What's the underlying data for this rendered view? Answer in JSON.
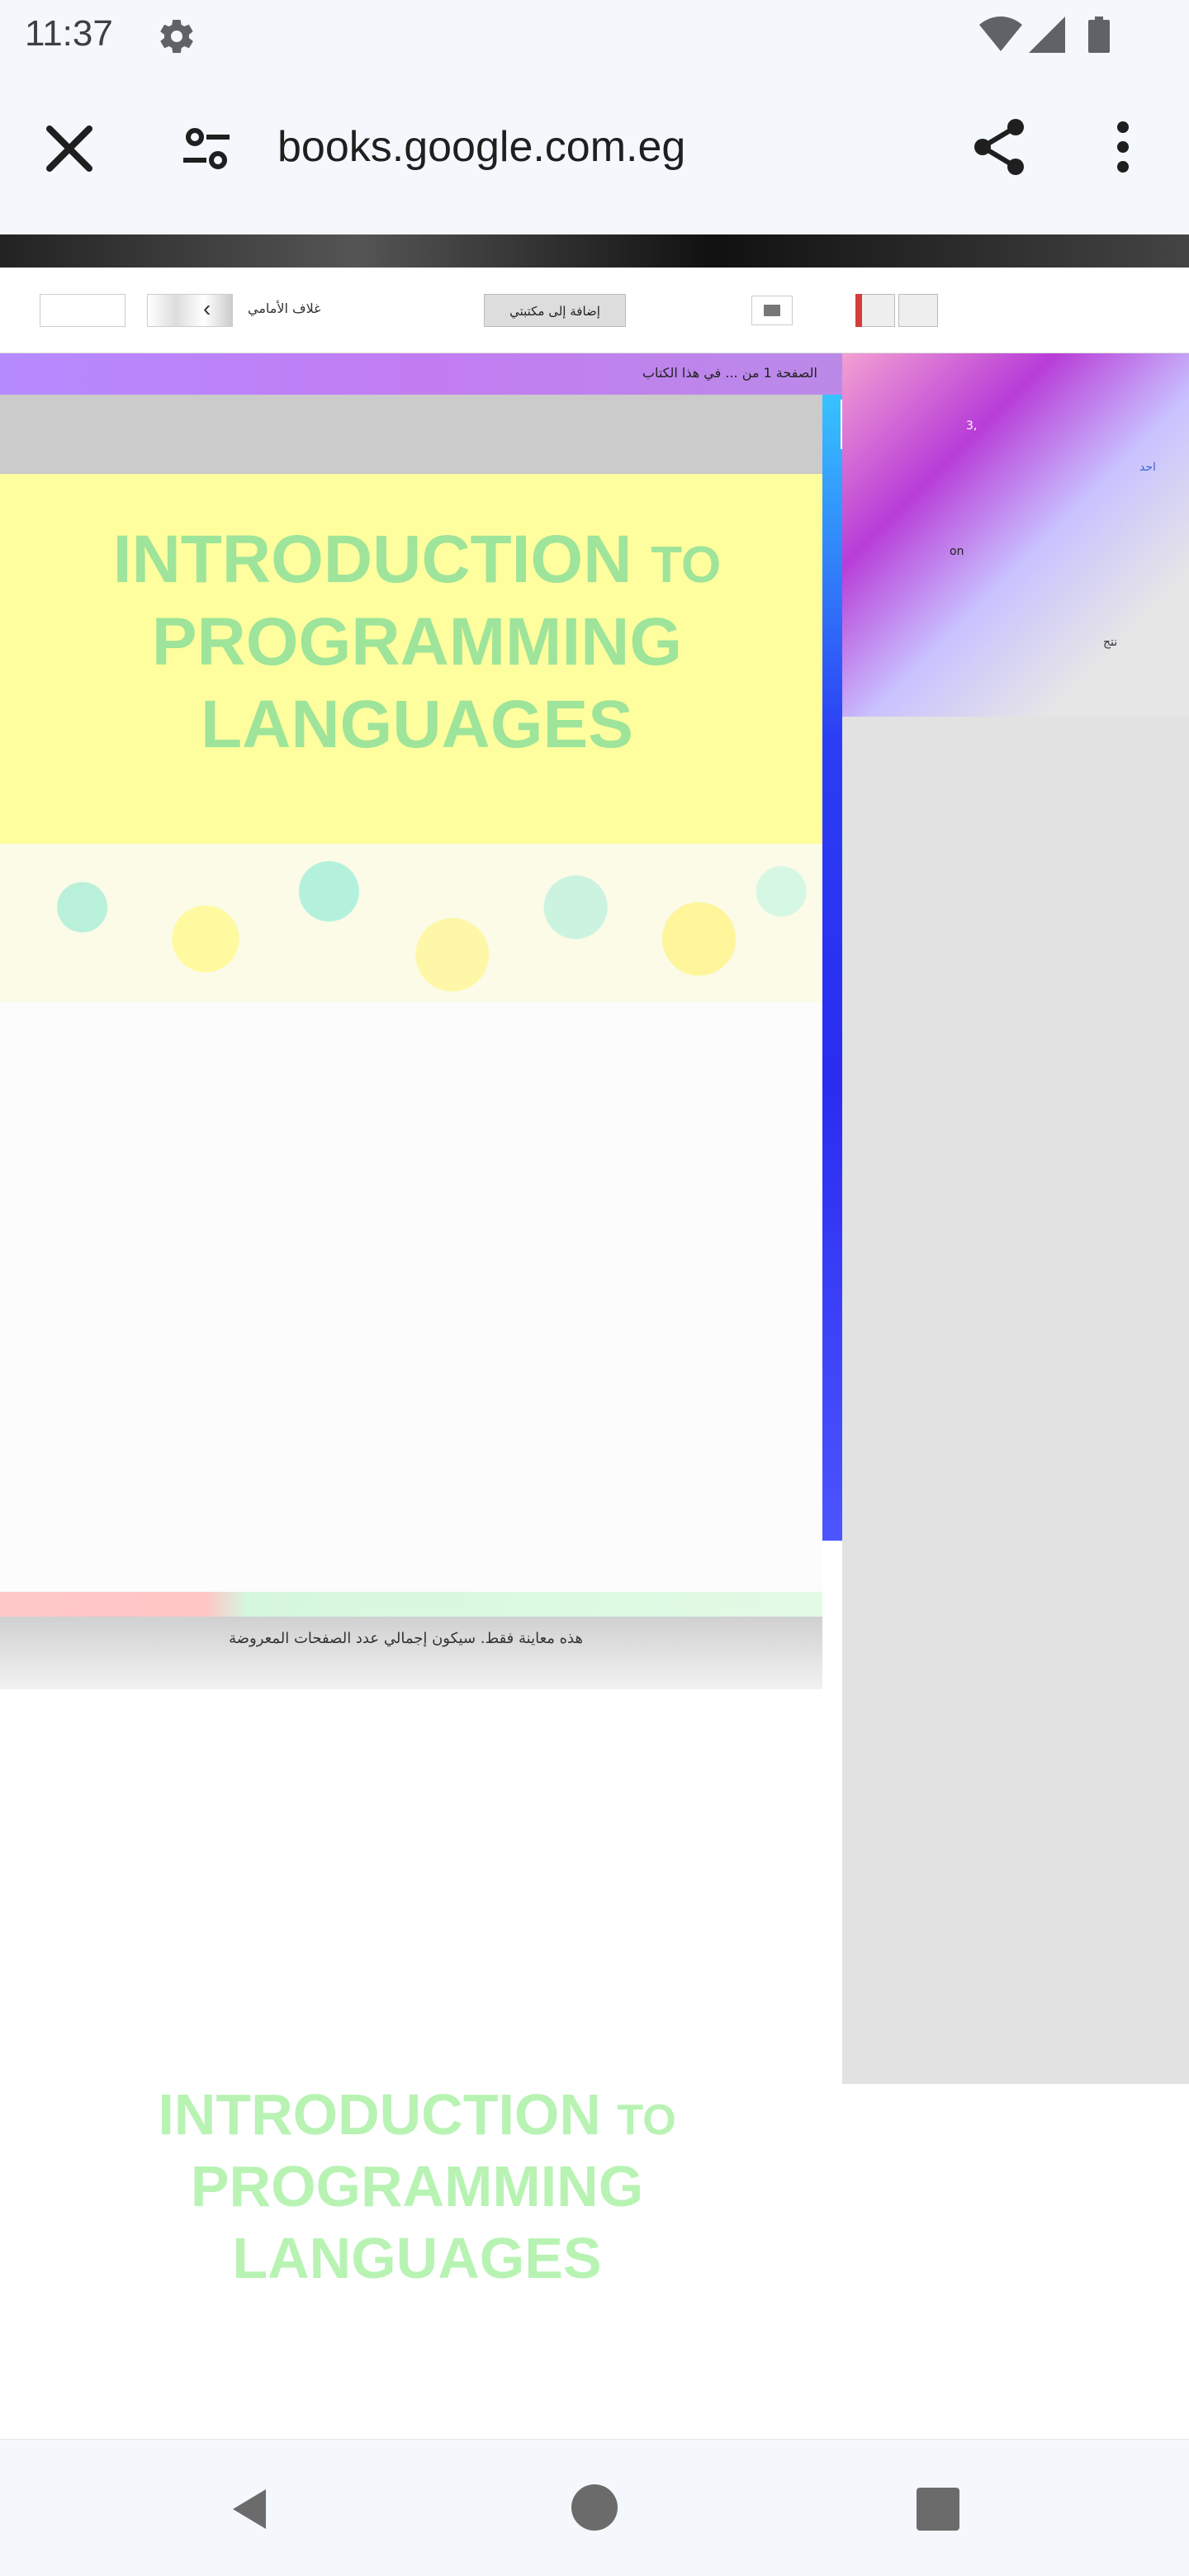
{
  "status_bar": {
    "time": "11:37"
  },
  "browser": {
    "url": "books.google.com.eg"
  },
  "toolbar": {
    "front_cover_label": "غلاف الأمامي",
    "add_to_library_label": "إضافة إلى مكتبتي"
  },
  "info_bar": {
    "text": "الصفحة 1 من ... في هذا الكتاب"
  },
  "book": {
    "title_line1": "INTRODUCTION",
    "title_to": "TO",
    "title_line2": "PROGRAMMING",
    "title_line3": "LANGUAGES",
    "notice": "هذه معاينة فقط. سيكون إجمالي عدد الصفحات المعروضة"
  },
  "sidebar": {
    "label1": "3,",
    "label2": "احد",
    "label3": "on",
    "label4": "نتج"
  },
  "colors": {
    "accent_green": "#9ee49a",
    "cover_yellow": "#fefe9e",
    "purple_bar": "#c27cf2"
  }
}
